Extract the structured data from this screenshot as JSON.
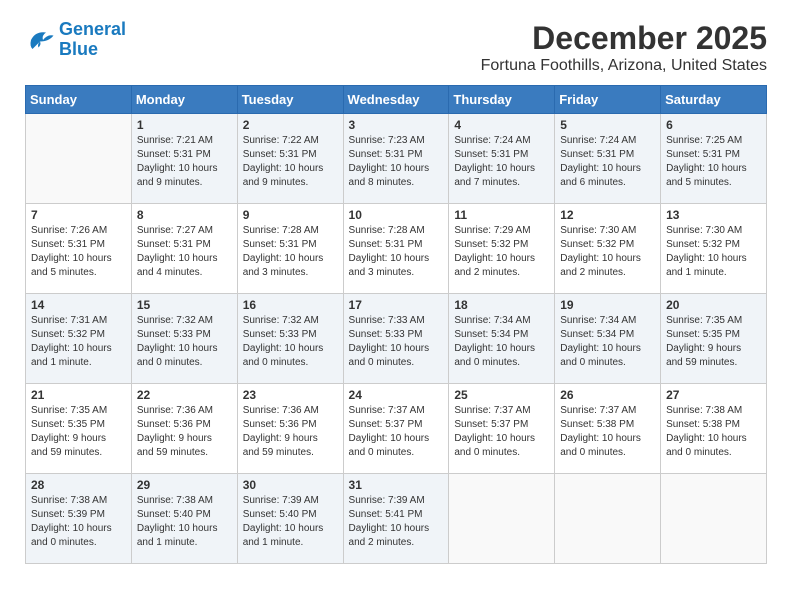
{
  "logo": {
    "general": "General",
    "blue": "Blue"
  },
  "title": {
    "month": "December 2025",
    "location": "Fortuna Foothills, Arizona, United States"
  },
  "weekdays": [
    "Sunday",
    "Monday",
    "Tuesday",
    "Wednesday",
    "Thursday",
    "Friday",
    "Saturday"
  ],
  "weeks": [
    [
      {
        "day": "",
        "info": ""
      },
      {
        "day": "1",
        "info": "Sunrise: 7:21 AM\nSunset: 5:31 PM\nDaylight: 10 hours\nand 9 minutes."
      },
      {
        "day": "2",
        "info": "Sunrise: 7:22 AM\nSunset: 5:31 PM\nDaylight: 10 hours\nand 9 minutes."
      },
      {
        "day": "3",
        "info": "Sunrise: 7:23 AM\nSunset: 5:31 PM\nDaylight: 10 hours\nand 8 minutes."
      },
      {
        "day": "4",
        "info": "Sunrise: 7:24 AM\nSunset: 5:31 PM\nDaylight: 10 hours\nand 7 minutes."
      },
      {
        "day": "5",
        "info": "Sunrise: 7:24 AM\nSunset: 5:31 PM\nDaylight: 10 hours\nand 6 minutes."
      },
      {
        "day": "6",
        "info": "Sunrise: 7:25 AM\nSunset: 5:31 PM\nDaylight: 10 hours\nand 5 minutes."
      }
    ],
    [
      {
        "day": "7",
        "info": "Sunrise: 7:26 AM\nSunset: 5:31 PM\nDaylight: 10 hours\nand 5 minutes."
      },
      {
        "day": "8",
        "info": "Sunrise: 7:27 AM\nSunset: 5:31 PM\nDaylight: 10 hours\nand 4 minutes."
      },
      {
        "day": "9",
        "info": "Sunrise: 7:28 AM\nSunset: 5:31 PM\nDaylight: 10 hours\nand 3 minutes."
      },
      {
        "day": "10",
        "info": "Sunrise: 7:28 AM\nSunset: 5:31 PM\nDaylight: 10 hours\nand 3 minutes."
      },
      {
        "day": "11",
        "info": "Sunrise: 7:29 AM\nSunset: 5:32 PM\nDaylight: 10 hours\nand 2 minutes."
      },
      {
        "day": "12",
        "info": "Sunrise: 7:30 AM\nSunset: 5:32 PM\nDaylight: 10 hours\nand 2 minutes."
      },
      {
        "day": "13",
        "info": "Sunrise: 7:30 AM\nSunset: 5:32 PM\nDaylight: 10 hours\nand 1 minute."
      }
    ],
    [
      {
        "day": "14",
        "info": "Sunrise: 7:31 AM\nSunset: 5:32 PM\nDaylight: 10 hours\nand 1 minute."
      },
      {
        "day": "15",
        "info": "Sunrise: 7:32 AM\nSunset: 5:33 PM\nDaylight: 10 hours\nand 0 minutes."
      },
      {
        "day": "16",
        "info": "Sunrise: 7:32 AM\nSunset: 5:33 PM\nDaylight: 10 hours\nand 0 minutes."
      },
      {
        "day": "17",
        "info": "Sunrise: 7:33 AM\nSunset: 5:33 PM\nDaylight: 10 hours\nand 0 minutes."
      },
      {
        "day": "18",
        "info": "Sunrise: 7:34 AM\nSunset: 5:34 PM\nDaylight: 10 hours\nand 0 minutes."
      },
      {
        "day": "19",
        "info": "Sunrise: 7:34 AM\nSunset: 5:34 PM\nDaylight: 10 hours\nand 0 minutes."
      },
      {
        "day": "20",
        "info": "Sunrise: 7:35 AM\nSunset: 5:35 PM\nDaylight: 9 hours\nand 59 minutes."
      }
    ],
    [
      {
        "day": "21",
        "info": "Sunrise: 7:35 AM\nSunset: 5:35 PM\nDaylight: 9 hours\nand 59 minutes."
      },
      {
        "day": "22",
        "info": "Sunrise: 7:36 AM\nSunset: 5:36 PM\nDaylight: 9 hours\nand 59 minutes."
      },
      {
        "day": "23",
        "info": "Sunrise: 7:36 AM\nSunset: 5:36 PM\nDaylight: 9 hours\nand 59 minutes."
      },
      {
        "day": "24",
        "info": "Sunrise: 7:37 AM\nSunset: 5:37 PM\nDaylight: 10 hours\nand 0 minutes."
      },
      {
        "day": "25",
        "info": "Sunrise: 7:37 AM\nSunset: 5:37 PM\nDaylight: 10 hours\nand 0 minutes."
      },
      {
        "day": "26",
        "info": "Sunrise: 7:37 AM\nSunset: 5:38 PM\nDaylight: 10 hours\nand 0 minutes."
      },
      {
        "day": "27",
        "info": "Sunrise: 7:38 AM\nSunset: 5:38 PM\nDaylight: 10 hours\nand 0 minutes."
      }
    ],
    [
      {
        "day": "28",
        "info": "Sunrise: 7:38 AM\nSunset: 5:39 PM\nDaylight: 10 hours\nand 0 minutes."
      },
      {
        "day": "29",
        "info": "Sunrise: 7:38 AM\nSunset: 5:40 PM\nDaylight: 10 hours\nand 1 minute."
      },
      {
        "day": "30",
        "info": "Sunrise: 7:39 AM\nSunset: 5:40 PM\nDaylight: 10 hours\nand 1 minute."
      },
      {
        "day": "31",
        "info": "Sunrise: 7:39 AM\nSunset: 5:41 PM\nDaylight: 10 hours\nand 2 minutes."
      },
      {
        "day": "",
        "info": ""
      },
      {
        "day": "",
        "info": ""
      },
      {
        "day": "",
        "info": ""
      }
    ]
  ]
}
